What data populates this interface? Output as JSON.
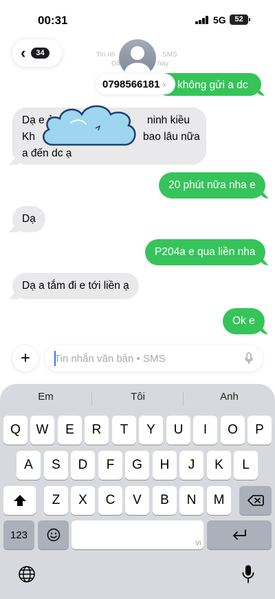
{
  "status_bar": {
    "time": "00:31",
    "network": "5G",
    "battery": "52"
  },
  "header": {
    "back_count": "34",
    "ghost_line_1": "Tin nh",
    "ghost_line_1b": "SMS",
    "ghost_line_2": "Đã",
    "ghost_line_2b": "hay",
    "phone_number": "0798566181",
    "phone_arrow": "›"
  },
  "messages": [
    {
      "dir": "out",
      "text": "không gửi a dc"
    },
    {
      "dir": "in",
      "line1a": "Dạ e ở",
      "line1b": "ninh kiều",
      "line2a": "Kh",
      "line2b": "bao lâu nữa",
      "line3": "a đến dc ạ"
    },
    {
      "dir": "out",
      "text": "20 phút nữa nha e"
    },
    {
      "dir": "in",
      "text": "Dạ"
    },
    {
      "dir": "out",
      "text": "P204a e qua liền nha"
    },
    {
      "dir": "in",
      "text": "Dạ a tắm đi e tới liền ạ"
    },
    {
      "dir": "out",
      "text": "Ok e"
    }
  ],
  "composer": {
    "plus": "+",
    "placeholder": "Tin nhắn văn bản • SMS"
  },
  "keyboard": {
    "suggestions": [
      "Em",
      "Tôi",
      "Anh"
    ],
    "row1": [
      "Q",
      "W",
      "E",
      "R",
      "T",
      "Y",
      "U",
      "I",
      "O",
      "P"
    ],
    "row2": [
      "A",
      "S",
      "D",
      "F",
      "G",
      "H",
      "J",
      "K",
      "L"
    ],
    "row3": [
      "Z",
      "X",
      "C",
      "V",
      "B",
      "N",
      "M"
    ],
    "numbers_key": "123",
    "language_hint": "VI"
  }
}
